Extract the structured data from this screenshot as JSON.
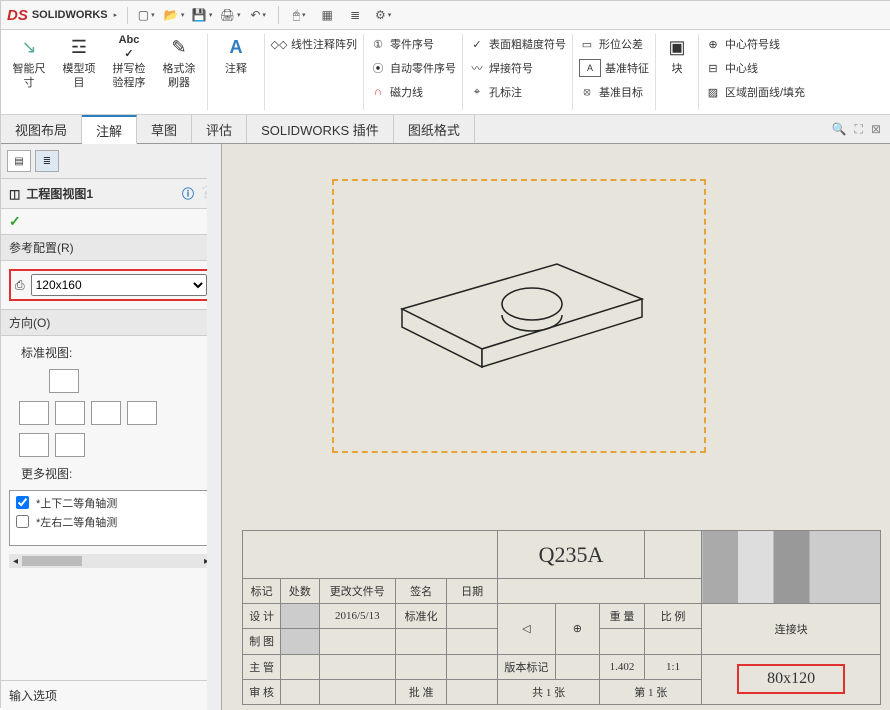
{
  "title": {
    "logo": "SOLIDWORKS",
    "dropdown_icon": "▸"
  },
  "qat": [
    {
      "icon": "▢",
      "name": "new"
    },
    {
      "icon": "📂",
      "name": "open"
    },
    {
      "icon": "💾",
      "name": "save"
    },
    {
      "icon": "🖨",
      "name": "print"
    },
    {
      "icon": "↶",
      "name": "undo"
    },
    {
      "icon": "↷",
      "name": "redo",
      "sep": true
    },
    {
      "icon": "⬚",
      "name": "select"
    },
    {
      "icon": "≣",
      "name": "rebuild"
    },
    {
      "icon": "⚙",
      "name": "options"
    }
  ],
  "ribbon": {
    "groups": [
      {
        "type": "big",
        "items": [
          {
            "label": "智能尺\n寸",
            "icon": "↘",
            "color": "#5a9"
          },
          {
            "label": "模型项\n目",
            "icon": "☲",
            "color": "#666"
          },
          {
            "label": "拼写检\n验程序",
            "icon": "Abc",
            "color": "#777"
          },
          {
            "label": "格式涂\n刷器",
            "icon": "✎",
            "color": "#999"
          }
        ]
      },
      {
        "type": "big",
        "items": [
          {
            "label": "注释",
            "icon": "A",
            "color": "#2f7bbf"
          }
        ]
      },
      {
        "type": "small",
        "cols": [
          [
            {
              "label": "线性注释阵列",
              "icon": "◇"
            }
          ]
        ]
      },
      {
        "type": "small",
        "cols": [
          [
            {
              "label": "零件序号",
              "icon": "①"
            },
            {
              "label": "自动零件序号",
              "icon": "⦿"
            },
            {
              "label": "磁力线",
              "icon": "∩"
            }
          ]
        ]
      },
      {
        "type": "small",
        "cols": [
          [
            {
              "label": "表面粗糙度符号",
              "icon": "✓"
            },
            {
              "label": "焊接符号",
              "icon": "〰"
            },
            {
              "label": "孔标注",
              "icon": "⌖"
            }
          ]
        ]
      },
      {
        "type": "small",
        "cols": [
          [
            {
              "label": "形位公差",
              "icon": "▭"
            },
            {
              "label": "基准特征",
              "icon": "A"
            },
            {
              "label": "基准目标",
              "icon": "⦻"
            }
          ]
        ]
      },
      {
        "type": "big",
        "items": [
          {
            "label": "块",
            "icon": "▣",
            "color": "#777"
          }
        ]
      },
      {
        "type": "small",
        "cols": [
          [
            {
              "label": "中心符号线",
              "icon": "⊕"
            },
            {
              "label": "中心线",
              "icon": "⊟"
            },
            {
              "label": "区域剖面线/填充",
              "icon": "▨"
            }
          ]
        ]
      }
    ]
  },
  "tabs": {
    "items": [
      {
        "label": "视图布局"
      },
      {
        "label": "注解",
        "active": true
      },
      {
        "label": "草图"
      },
      {
        "label": "评估"
      },
      {
        "label": "SOLIDWORKS 插件"
      },
      {
        "label": "图纸格式"
      }
    ]
  },
  "side": {
    "header_title": "工程图视图1",
    "ref_config": {
      "title": "参考配置(R)",
      "value": "120x160"
    },
    "orientation": {
      "title": "方向(O)",
      "std_label": "标准视图:",
      "more_label": "更多视图:",
      "iso1": "*上下二等角轴测",
      "iso2": "*左右二等角轴测",
      "iso1_checked": true,
      "iso2_checked": false
    },
    "input_options": "输入选项"
  },
  "titleblock": {
    "material": "Q235A",
    "row_headers": {
      "mark": "标记",
      "places": "处数",
      "chgfile": "更改文件号",
      "sign": "签名",
      "date": "日期"
    },
    "rows": {
      "design": "设 计",
      "design_date": "2016/5/13",
      "std": "标准化",
      "audit": "制 图",
      "ver_mark": "版本标记",
      "ver_val": "1.402",
      "scale": "1:1",
      "chief": "主 管",
      "approve": "批 准",
      "sheet_total": "共 1 张",
      "sheet_no": "第 1 张",
      "check": "审 核",
      "weight": "重 量",
      "ratio": "比 例",
      "partname": "连接块"
    },
    "config_name": "80x120"
  }
}
